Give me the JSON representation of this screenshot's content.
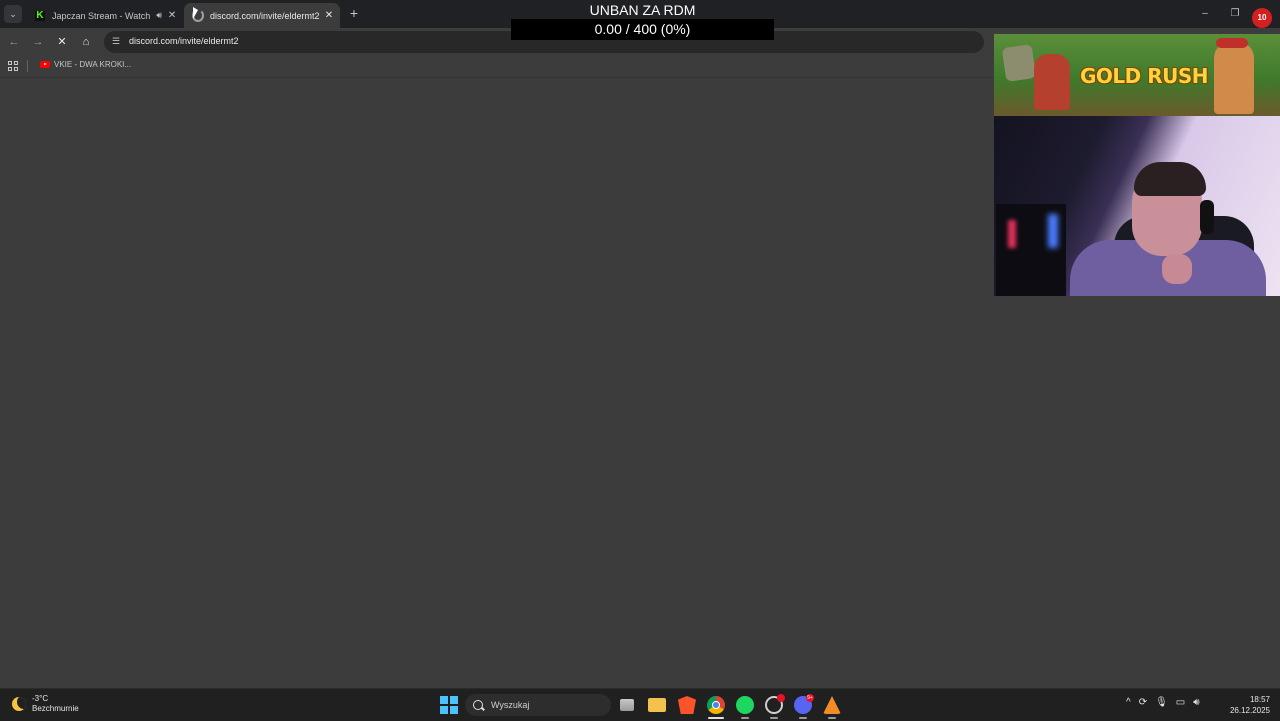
{
  "browser": {
    "tabs": [
      {
        "title": "Japczan Stream - Watch Live",
        "icon": "kick-icon",
        "audio": true,
        "active": false
      },
      {
        "title": "discord.com/invite/eldermt2",
        "icon": "loading-icon",
        "audio": false,
        "active": true
      }
    ],
    "address_url": "discord.com/invite/eldermt2",
    "bookmarks": [
      {
        "label": "VKIE - DWA KROKI...",
        "icon": "youtube-icon"
      }
    ],
    "window_controls": {
      "minimize": "–",
      "restore": "❐",
      "close": "✕"
    }
  },
  "overlay": {
    "title": "UNBAN ZA RDM",
    "progress_text": "0.00 / 400 (0%)",
    "progress_current": 0,
    "progress_goal": 400
  },
  "game_banner": {
    "title": "GOLD RUSH"
  },
  "corner_logo": {
    "text": "10"
  },
  "taskbar": {
    "weather_temp": "-3°C",
    "weather_desc": "Bezchmurnie",
    "search_placeholder": "Wyszukaj",
    "time": "18:57",
    "date": "26.12.2025",
    "discord_badge": "9+"
  },
  "colors": {
    "page_bg": "#3c3c3c",
    "tabstrip_bg": "#202124",
    "taskbar_bg": "#202020",
    "accent_windows": "#4cc2ff"
  }
}
